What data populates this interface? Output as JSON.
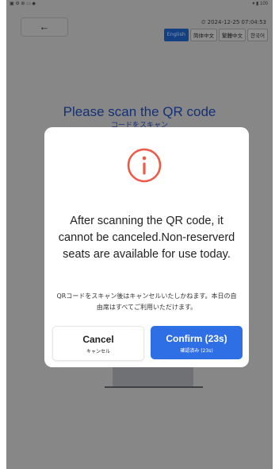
{
  "statusbar": {
    "left": "▣ ⚙ ⊕ ▭ ◆",
    "right": "▾ ▮ 100"
  },
  "header": {
    "back_icon": "←",
    "datetime": "⏲ 2024-12-25 07:04:53",
    "languages": [
      "English",
      "简体中文",
      "繁體中文",
      "한국어"
    ],
    "active_language": "English"
  },
  "main": {
    "title": "Please scan the QR code",
    "subtitle": "コードをスキャン"
  },
  "dialog": {
    "icon": "alert-circle-icon",
    "accent_color": "#ee5a4a",
    "message": "After scanning the QR code, it cannot be canceled.Non-reserverd seats are available for use today.",
    "message_jp": "QRコードをスキャン後はキャンセルいたしかねます。本日の自由席はすべてご利用いただけます。",
    "cancel_label": "Cancel",
    "cancel_sub": "キャンセル",
    "confirm_label": "Confirm (23s)",
    "confirm_sub": "確認済み (23s)",
    "confirm_color": "#2f6fe6"
  }
}
